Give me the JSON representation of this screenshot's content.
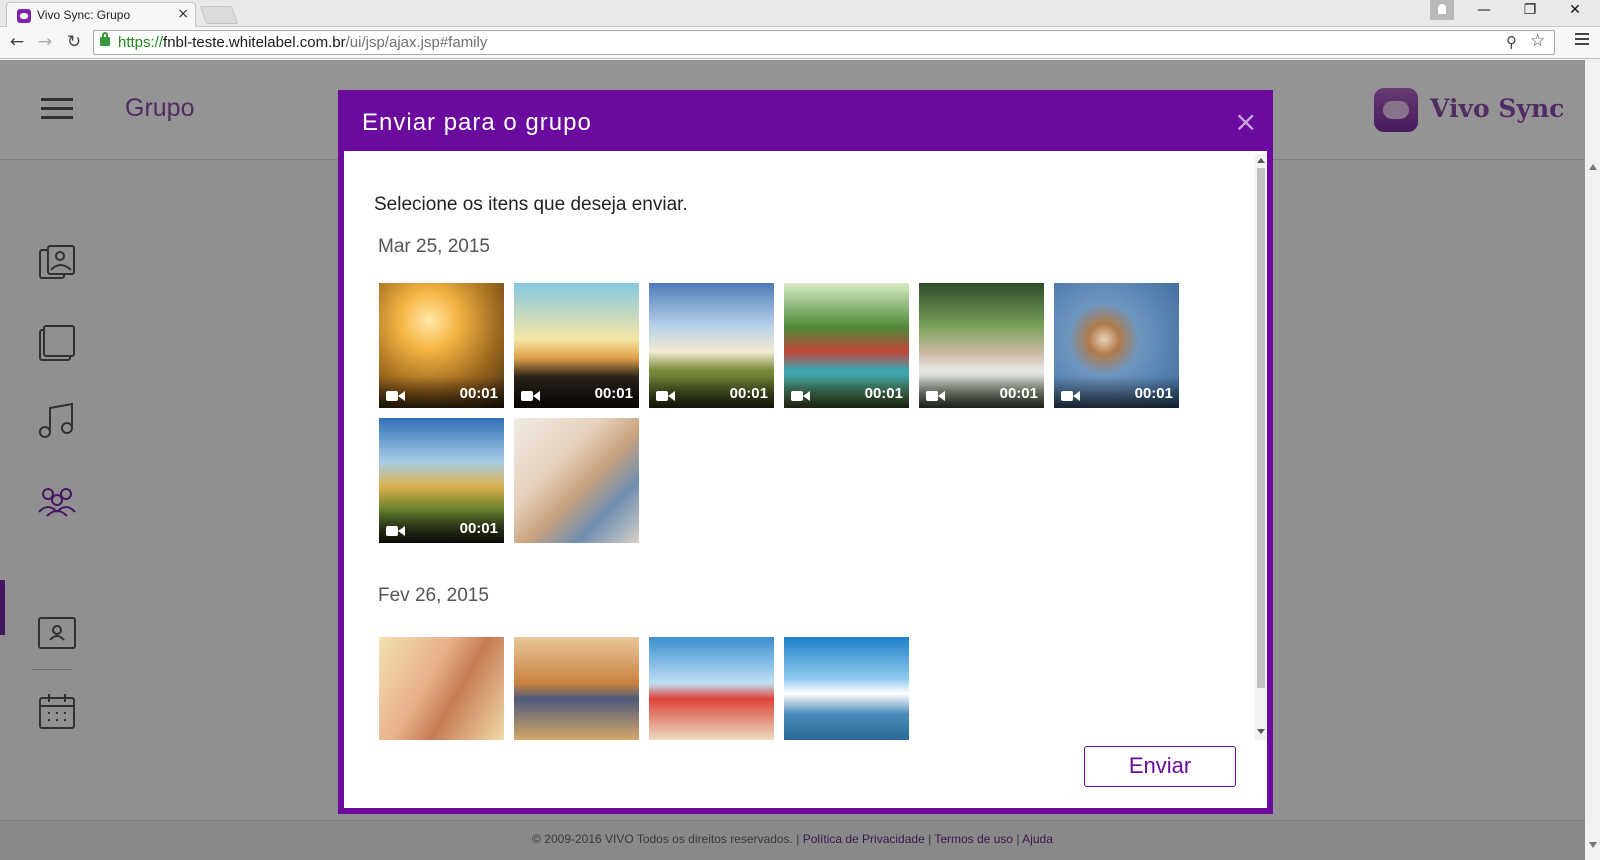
{
  "browser": {
    "tab_title": "Vivo Sync: Grupo",
    "tab_close": "×",
    "url_scheme": "https://",
    "url_host": "fnbl-teste.whitelabel.com.br",
    "url_path": "/ui/jsp/ajax.jsp#family",
    "window_buttons": {
      "minimize": "—",
      "restore": "❐",
      "close": "✕"
    },
    "nav": {
      "back": "←",
      "forward": "→",
      "reload": "↻"
    },
    "zoom_icon": "⚲",
    "star_icon": "☆"
  },
  "app": {
    "title": "Grupo",
    "brand": "Vivo Sync",
    "sidebar_icons": [
      "photos-icon",
      "documents-icon",
      "music-icon",
      "group-icon",
      "contacts-icon",
      "calendar-icon"
    ]
  },
  "modal": {
    "title": "Enviar para o grupo",
    "close": "×",
    "instructions": "Selecione os itens que deseja enviar.",
    "sections": [
      {
        "date": "Mar 25, 2015",
        "items": [
          {
            "type": "video",
            "duration": "00:01",
            "scene": "girl in sunset field"
          },
          {
            "type": "video",
            "duration": "00:01",
            "scene": "silhouettes at sunset"
          },
          {
            "type": "video",
            "duration": "00:01",
            "scene": "family walking in field"
          },
          {
            "type": "video",
            "duration": "00:01",
            "scene": "kids running in park"
          },
          {
            "type": "video",
            "duration": "00:01",
            "scene": "children splashing in water"
          },
          {
            "type": "video",
            "duration": "00:01",
            "scene": "beagle in water"
          },
          {
            "type": "video",
            "duration": "00:01",
            "scene": "road through autumn trees"
          },
          {
            "type": "photo",
            "scene": "mother and daughter with tablet"
          }
        ]
      },
      {
        "date": "Fev 26, 2015",
        "items": [
          {
            "type": "photo",
            "scene": "mother and child on beach"
          },
          {
            "type": "photo",
            "scene": "woman sitting on rocks"
          },
          {
            "type": "photo",
            "scene": "family walking on beach"
          },
          {
            "type": "photo",
            "scene": "woman with arms raised by sea"
          }
        ]
      }
    ],
    "send_label": "Enviar"
  },
  "footer": {
    "copyright": "© 2009-2016 VIVO Todos os direitos reservados. | ",
    "privacy": "Política de Privacidade",
    "sep": " | ",
    "terms": "Termos de uso",
    "help": "Ajuda"
  },
  "colors": {
    "accent": "#6a0a9e",
    "brand": "#8e4aaf"
  }
}
